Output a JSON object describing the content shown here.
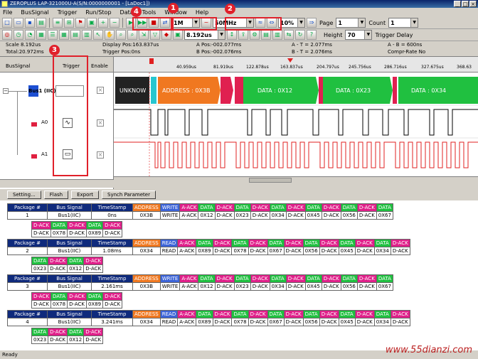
{
  "window": {
    "title": "ZEROPLUS LAP-321000U-A(S/N:0000000001 - [LaDoc1])"
  },
  "menu": [
    "File",
    "BusSignal",
    "Trigger",
    "Run/Stop",
    "Data",
    "Tools",
    "Window",
    "Help"
  ],
  "toolbar": {
    "sample_depth": "1M",
    "sample_rate": "50MHz",
    "trigger_position": "10%",
    "page_label": "Page",
    "page_value": "1",
    "count_label": "Count",
    "count_value": "1",
    "scale_value": "8.192us",
    "height_label": "Height",
    "height_value": "70",
    "trigger_delay_label": "Trigger Delay"
  },
  "info": {
    "scale": "Scale 8.192us",
    "total": "Total:20.972ms",
    "display_pos": "Display Pos:163.837us",
    "trigger_pos": "Trigger Pos:0ns",
    "a_pos": "A Pos:-002.077ms",
    "b_pos": "B Pos:-002.076ms",
    "a_t": "A - T = 2.077ms",
    "b_t": "B - T = 2.076ms",
    "a_b": "A - B = 600ns",
    "compress": "Compr-Rate No"
  },
  "left": {
    "col_bus": "BusSignal",
    "col_trigger": "Trigger",
    "col_enable": "Enable",
    "bus_name": "Bus1 (IIC)",
    "ch0": "A0",
    "ch1": "A1"
  },
  "ruler": [
    "40.959us",
    "81.919us",
    "122.878us",
    "163.837us",
    "204.797us",
    "245.756us",
    "286.716us",
    "327.675us",
    "368.63"
  ],
  "wave": {
    "seg1": "UNKNOW",
    "seg2": "ADDRESS : 0X3B",
    "seg3": "DATA : 0X12",
    "seg4": "DATA : 0X23",
    "seg5": "DATA : 0X34"
  },
  "badges": [
    "1",
    "2",
    "3",
    "4"
  ],
  "buttons": [
    "Setting...",
    "Flash",
    "Export",
    "Synch Parameter"
  ],
  "packets": [
    {
      "hdr": [
        "Package #",
        "Bus Signal",
        "TimeStamp"
      ],
      "num": "1",
      "bus": "Bus1(IIC)",
      "ts": "0ns",
      "row1": [
        [
          "ADDRESS",
          "o",
          "0X3B"
        ],
        [
          "WRITE",
          "b",
          "WRITE"
        ],
        [
          "A-ACK",
          "p",
          "A-ACK"
        ],
        [
          "DATA",
          "g",
          "0X12"
        ],
        [
          "D-ACK",
          "p",
          "D-ACK"
        ],
        [
          "DATA",
          "g",
          "0X23"
        ],
        [
          "D-ACK",
          "p",
          "D-ACK"
        ],
        [
          "DATA",
          "g",
          "0X34"
        ],
        [
          "D-ACK",
          "p",
          "D-ACK"
        ],
        [
          "DATA",
          "g",
          "0X45"
        ],
        [
          "D-ACK",
          "p",
          "D-ACK"
        ],
        [
          "DATA",
          "g",
          "0X56"
        ],
        [
          "D-ACK",
          "p",
          "D-ACK"
        ],
        [
          "DATA",
          "g",
          "0X67"
        ]
      ],
      "row2": [
        [
          "D-ACK",
          "p",
          "D-ACK"
        ],
        [
          "DATA",
          "g",
          "0X78"
        ],
        [
          "D-ACK",
          "p",
          "D-ACK"
        ],
        [
          "DATA",
          "g",
          "0X89"
        ],
        [
          "D-ACK",
          "p",
          "D-ACK"
        ]
      ]
    },
    {
      "hdr": [
        "Package #",
        "Bus Signal",
        "TimeStamp"
      ],
      "num": "2",
      "bus": "Bus1(IIC)",
      "ts": "1.08ms",
      "row1": [
        [
          "ADDRESS",
          "o",
          "0X34"
        ],
        [
          "READ",
          "b",
          "READ"
        ],
        [
          "A-ACK",
          "p",
          "A-ACK"
        ],
        [
          "DATA",
          "g",
          "0X89"
        ],
        [
          "D-ACK",
          "p",
          "D-ACK"
        ],
        [
          "DATA",
          "g",
          "0X78"
        ],
        [
          "D-ACK",
          "p",
          "D-ACK"
        ],
        [
          "DATA",
          "g",
          "0X67"
        ],
        [
          "D-ACK",
          "p",
          "D-ACK"
        ],
        [
          "DATA",
          "g",
          "0X56"
        ],
        [
          "D-ACK",
          "p",
          "D-ACK"
        ],
        [
          "DATA",
          "g",
          "0X45"
        ],
        [
          "D-ACK",
          "p",
          "D-ACK"
        ],
        [
          "DATA",
          "g",
          "0X34"
        ],
        [
          "D-ACK",
          "p",
          "D-ACK"
        ]
      ],
      "row2": [
        [
          "DATA",
          "g",
          "0X23"
        ],
        [
          "D-ACK",
          "p",
          "D-ACK"
        ],
        [
          "DATA",
          "g",
          "0X12"
        ],
        [
          "D-ACK",
          "p",
          "D-ACK"
        ]
      ]
    },
    {
      "hdr": [
        "Package #",
        "Bus Signal",
        "TimeStamp"
      ],
      "num": "3",
      "bus": "Bus1(IIC)",
      "ts": "2.161ms",
      "row1": [
        [
          "ADDRESS",
          "o",
          "0X3B"
        ],
        [
          "WRITE",
          "b",
          "WRITE"
        ],
        [
          "A-ACK",
          "p",
          "A-ACK"
        ],
        [
          "DATA",
          "g",
          "0X12"
        ],
        [
          "D-ACK",
          "p",
          "D-ACK"
        ],
        [
          "DATA",
          "g",
          "0X23"
        ],
        [
          "D-ACK",
          "p",
          "D-ACK"
        ],
        [
          "DATA",
          "g",
          "0X34"
        ],
        [
          "D-ACK",
          "p",
          "D-ACK"
        ],
        [
          "DATA",
          "g",
          "0X45"
        ],
        [
          "D-ACK",
          "p",
          "D-ACK"
        ],
        [
          "DATA",
          "g",
          "0X56"
        ],
        [
          "D-ACK",
          "p",
          "D-ACK"
        ],
        [
          "DATA",
          "g",
          "0X67"
        ]
      ],
      "row2": [
        [
          "D-ACK",
          "p",
          "D-ACK"
        ],
        [
          "DATA",
          "g",
          "0X78"
        ],
        [
          "D-ACK",
          "p",
          "D-ACK"
        ],
        [
          "DATA",
          "g",
          "0X89"
        ],
        [
          "D-ACK",
          "p",
          "D-ACK"
        ]
      ]
    },
    {
      "hdr": [
        "Package #",
        "Bus Signal",
        "TimeStamp"
      ],
      "num": "4",
      "bus": "Bus1(IIC)",
      "ts": "3.241ms",
      "row1": [
        [
          "ADDRESS",
          "o",
          "0X34"
        ],
        [
          "READ",
          "b",
          "READ"
        ],
        [
          "A-ACK",
          "p",
          "A-ACK"
        ],
        [
          "DATA",
          "g",
          "0X89"
        ],
        [
          "D-ACK",
          "p",
          "D-ACK"
        ],
        [
          "DATA",
          "g",
          "0X78"
        ],
        [
          "D-ACK",
          "p",
          "D-ACK"
        ],
        [
          "DATA",
          "g",
          "0X67"
        ],
        [
          "D-ACK",
          "p",
          "D-ACK"
        ],
        [
          "DATA",
          "g",
          "0X56"
        ],
        [
          "D-ACK",
          "p",
          "D-ACK"
        ],
        [
          "DATA",
          "g",
          "0X45"
        ],
        [
          "D-ACK",
          "p",
          "D-ACK"
        ],
        [
          "DATA",
          "g",
          "0X34"
        ],
        [
          "D-ACK",
          "p",
          "D-ACK"
        ]
      ],
      "row2": [
        [
          "DATA",
          "g",
          "0X23"
        ],
        [
          "D-ACK",
          "p",
          "D-ACK"
        ],
        [
          "DATA",
          "g",
          "0X12"
        ],
        [
          "D-ACK",
          "p",
          "D-ACK"
        ]
      ]
    }
  ],
  "status": "Ready",
  "watermark": "www.55dianzi.com"
}
